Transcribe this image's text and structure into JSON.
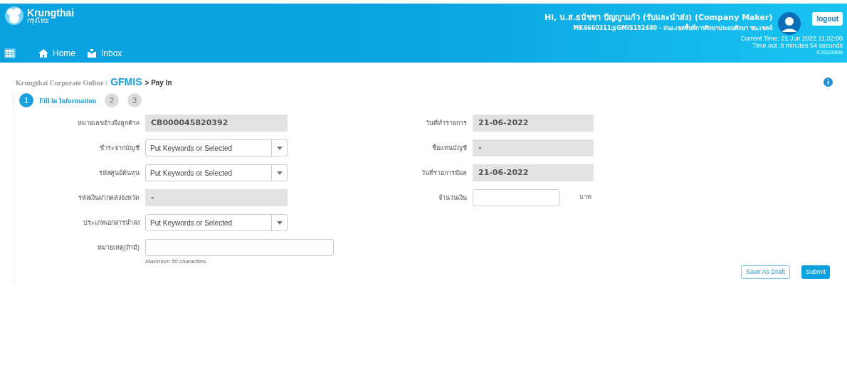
{
  "header": {
    "brand": "Krungthai",
    "brand_sub": "กรุงไทย",
    "nav": [
      {
        "label": "Home",
        "kind": "home"
      },
      {
        "label": "Inbox",
        "kind": "inbox"
      }
    ],
    "greeting": "Hi, น.ส.ธนัชชา ปัญญาแก้ว (รับและนำส่ง) (Company Maker)",
    "account": "MK4660311@GMIS152480 - สนง.เขตพื้นที่การศึกษาประถมศึกษา ชม.เขต4",
    "logout": "logout",
    "current_time": "Current Time: 21 Jun 2022 11:32:00",
    "timeout": "Time out :8 minutes 54 seconds",
    "version": "V.20220609"
  },
  "breadcrumb": {
    "root": "Krungthai Corporate Online :",
    "section": "GFMIS",
    "page": "> Pay In"
  },
  "steps": [
    {
      "number": "1",
      "label": "Fill in Information",
      "selected": true
    },
    {
      "number": "2",
      "selected": false
    },
    {
      "number": "3",
      "selected": false
    }
  ],
  "left_fields": [
    {
      "label": "หมายเลขอ้างอิงลูกค้า#",
      "kind": "readonly",
      "value": "CB000045820392"
    },
    {
      "label": "ชำระจากบัญชี",
      "kind": "select",
      "placeholder": "Put Keywords or Selected"
    },
    {
      "label": "รหัสศูนย์ต้นทุน",
      "kind": "select",
      "placeholder": "Put Keywords or Selected"
    },
    {
      "label": "รหัสเงินฝากคลังจังหวัด",
      "kind": "readonly",
      "value": "-"
    },
    {
      "label": "ประเภทเอกสารนำส่ง",
      "kind": "select",
      "placeholder": "Put Keywords or Selected"
    },
    {
      "label": "หมายเหตุ(ถ้ามี)",
      "kind": "text",
      "hint": "Maximum 50 characters."
    }
  ],
  "right_fields": [
    {
      "label": "วันที่ทำรายการ",
      "kind": "readonly",
      "value": "21-06-2022"
    },
    {
      "label": "ชื่อแทนบัญชี",
      "kind": "readonly",
      "value": "-"
    },
    {
      "label": "วันที่รายการมีผล",
      "kind": "readonly",
      "value": "21-06-2022"
    },
    {
      "label": "จำนวนเงิน",
      "kind": "text",
      "unit": "บาท"
    }
  ],
  "buttons": [
    {
      "label": "Save As Draft",
      "kind": "outline"
    },
    {
      "label": "Submit",
      "kind": "primary"
    }
  ]
}
